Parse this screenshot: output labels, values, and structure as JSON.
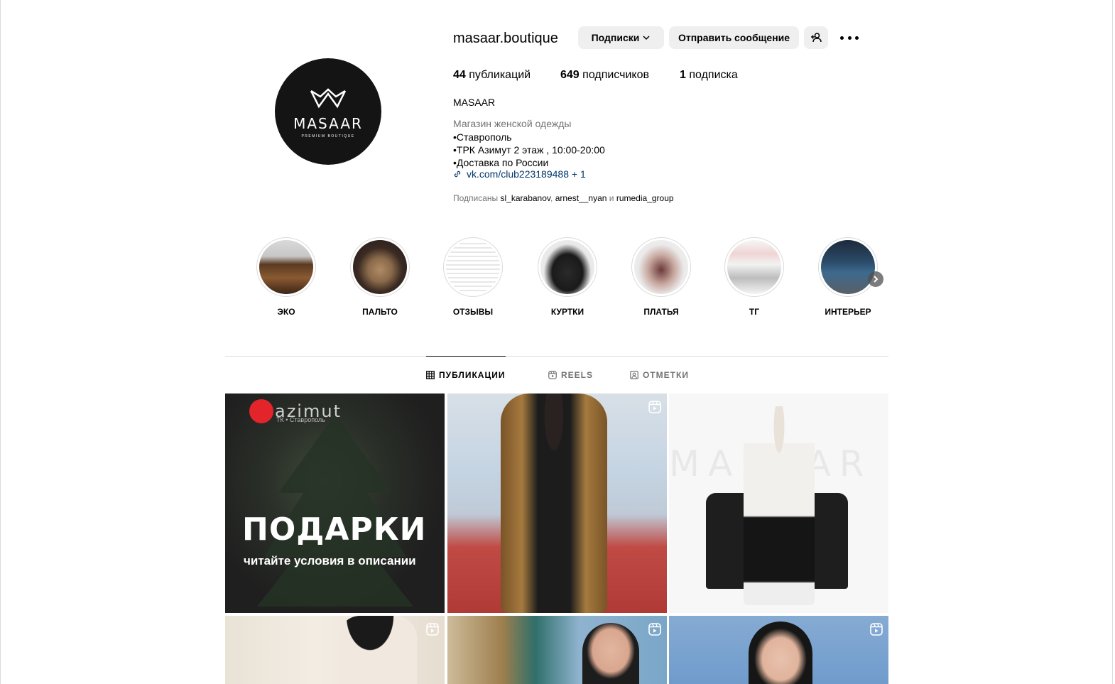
{
  "profile": {
    "username": "masaar.boutique",
    "avatar_name": "MASAAR",
    "avatar_tagline": "PREMIUM BOUTIQUE",
    "buttons": {
      "following": "Подписки",
      "message": "Отправить сообщение"
    },
    "stats": {
      "posts_count": "44",
      "posts_label": "публикаций",
      "followers_count": "649",
      "followers_label": "подписчиков",
      "following_count": "1",
      "following_label": "подписка"
    },
    "full_name": "MASAAR",
    "category": "Магазин женской одежды",
    "bio_lines": [
      "•Ставрополь",
      "•ТРК Азимут 2 этаж , 10:00-20:00",
      "•Доставка по России"
    ],
    "link": "vk.com/club223189488 + 1",
    "followed_by_prefix": "Подписаны",
    "followed_by": [
      "sl_karabanov",
      "arnest__nyan",
      "rumedia_group"
    ],
    "followed_by_sep": ",",
    "followed_by_and": "и"
  },
  "highlights": [
    {
      "label": "ЭКО"
    },
    {
      "label": "ПАЛЬТО"
    },
    {
      "label": "ОТЗЫВЫ"
    },
    {
      "label": "КУРТКИ"
    },
    {
      "label": "ПЛАТЬЯ"
    },
    {
      "label": "ТГ"
    },
    {
      "label": "ИНТЕРЬЕР"
    }
  ],
  "tabs": [
    {
      "label": "ПУБЛИКАЦИИ",
      "icon": "grid-icon",
      "active": true
    },
    {
      "label": "REELS",
      "icon": "reels-icon",
      "active": false
    },
    {
      "label": "ОТМЕТКИ",
      "icon": "tagged-icon",
      "active": false
    }
  ],
  "posts": {
    "p1": {
      "brand": "azimut",
      "brand_sub": "ТК • Ставрополь",
      "title": "ПОДАРКИ",
      "subtitle": "читайте условия в описании"
    },
    "p3": {
      "watermark": "MASAAR"
    }
  },
  "colors": {
    "link": "#00376b",
    "secondary_text": "#737373",
    "button_bg": "#efefef",
    "divider": "#dbdbdb"
  }
}
